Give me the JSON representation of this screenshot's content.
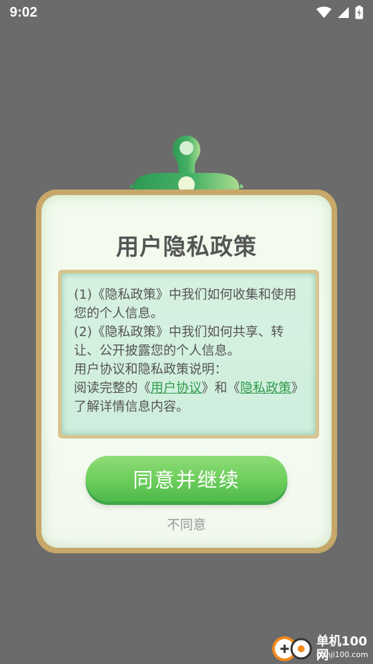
{
  "status": {
    "time": "9:02"
  },
  "dialog": {
    "title": "用户隐私政策",
    "lines": {
      "l1": "(1)《隐私政策》中我们如何收集和使用您的个人信息。",
      "l2": "(2)《隐私政策》中我们如何共享、转让、公开披露您的个人信息。",
      "l3": "用户协议和隐私政策说明：",
      "l4_prefix": "阅读完整的《",
      "l4_link1": "用户协议",
      "l4_mid": "》和《",
      "l4_link2": "隐私政策",
      "l4_suffix": "》了解详情信息内容。"
    },
    "agree_button": "同意并继续",
    "disagree_button": "不同意"
  },
  "watermark": {
    "name": "单机100网",
    "url": "danji100.com"
  },
  "colors": {
    "background": "#6b6b6b",
    "card_border": "#c7a76a",
    "accent_green": "#6bcd5b",
    "link_green": "#2f9b4c"
  }
}
